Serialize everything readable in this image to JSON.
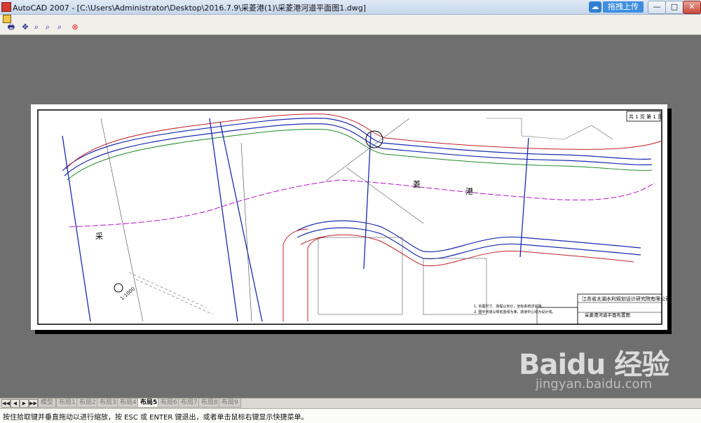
{
  "titlebar": {
    "title": "AutoCAD 2007 - [C:\\Users\\Administrator\\Desktop\\2016.7.9\\采菱港(1)\\采菱港河道平面图1.dwg]",
    "upload_label": "拖拽上传",
    "min_label": "—",
    "max_label": "□",
    "close_label": "✕"
  },
  "toolbar": {
    "icons": [
      "plot-icon",
      "pan-icon",
      "zoom-realtime-icon",
      "zoom-window-icon",
      "zoom-previous-icon",
      "close-icon"
    ]
  },
  "drawing": {
    "sheet_number": "共 1 页  第 1 页",
    "title_block_org": "江苏省太湖水利规划设计研究院有限公司",
    "title_block_project": "采菱港河道平面布置图",
    "notes": [
      "1. 本图尺寸、高程以米计，坐标系统详说明。",
      "2. 图中河道以规划蓝线为准，航道中心线为设计线。"
    ],
    "river_labels": [
      "采",
      "菱",
      "港"
    ],
    "scale_label": "1:1000"
  },
  "layout_tabs": {
    "nav": [
      "◀◀",
      "◀",
      "▶",
      "▶▶"
    ],
    "tabs": [
      "模型",
      "布局1",
      "布局2",
      "布局3",
      "布局4",
      "布局5",
      "布局6",
      "布局7",
      "布局8",
      "布局9"
    ],
    "active": "布局5"
  },
  "command_line": {
    "text": "按住拾取键并垂直拖动以进行缩放，按 ESC 或 ENTER 键退出，或者单击鼠标右键显示快捷菜单。"
  },
  "watermark": {
    "main": "Baidu 经验",
    "sub": "jingyan.baidu.com"
  },
  "colors": {
    "background": "#6f6f6f",
    "river_blue": "#1b2bb0",
    "boundary_red": "#c2202a",
    "centerline_magenta": "#b316c8",
    "green_line": "#1f8a2a"
  }
}
